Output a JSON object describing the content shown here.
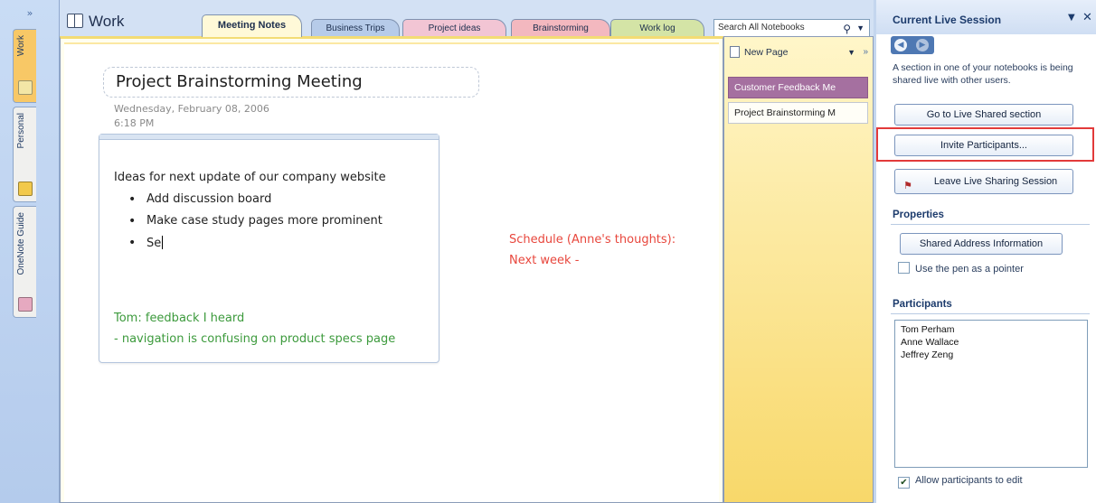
{
  "notebooks": [
    {
      "label": "Work",
      "icon": "notebook-icon",
      "color": "#f8c866"
    },
    {
      "label": "Personal",
      "icon": "notebook-icon",
      "color": "#f2c94c"
    },
    {
      "label": "OneNote Guide",
      "icon": "notebook-icon",
      "color": "#e6a9c0"
    }
  ],
  "rail_collapse": "»",
  "notebook_title": "Work",
  "section_tabs": [
    {
      "label": "Meeting Notes",
      "active": true,
      "color": "#fff9d8"
    },
    {
      "label": "Business Trips",
      "color": "#b6cbe9"
    },
    {
      "label": "Project ideas",
      "color": "#f2c5d4"
    },
    {
      "label": "Brainstorming",
      "color": "#f3b8bf"
    },
    {
      "label": "Work log",
      "color": "#d4e4a6"
    }
  ],
  "search": {
    "placeholder": "Search All Notebooks"
  },
  "page": {
    "title": "Project Brainstorming Meeting",
    "date": "Wednesday, February 08, 2006",
    "time": "6:18 PM",
    "outline_heading": "Ideas for next update of our company website",
    "bullets": [
      "Add discussion board",
      "Make case study pages more prominent",
      "Se"
    ],
    "tom_line1": "Tom: feedback I heard",
    "tom_line2": " - navigation is confusing on product specs page",
    "anne_line1": "Schedule (Anne's thoughts):",
    "anne_line2": "Next week -"
  },
  "page_list": {
    "new_page": "New Page",
    "more": "»",
    "items": [
      "Customer Feedback Me",
      "Project Brainstorming M"
    ]
  },
  "pane": {
    "title": "Current Live Session",
    "description": "A section in one of your notebooks is being shared live with other users.",
    "buttons": {
      "goto": "Go to Live Shared section",
      "invite": "Invite Participants...",
      "leave": "Leave Live Sharing Session",
      "address": "Shared Address Information"
    },
    "properties_heading": "Properties",
    "pen_pointer": "Use the pen as a pointer",
    "participants_heading": "Participants",
    "participants": [
      "Tom Perham",
      "Anne Wallace",
      "Jeffrey Zeng"
    ],
    "allow_edit": "Allow participants to edit",
    "allow_edit_checked": true,
    "pen_pointer_checked": false
  },
  "colors": {
    "highlight": "#e23a3a",
    "green_note": "#3c9a3c",
    "red_note": "#e8473d",
    "selected_page": "#a570a0"
  }
}
